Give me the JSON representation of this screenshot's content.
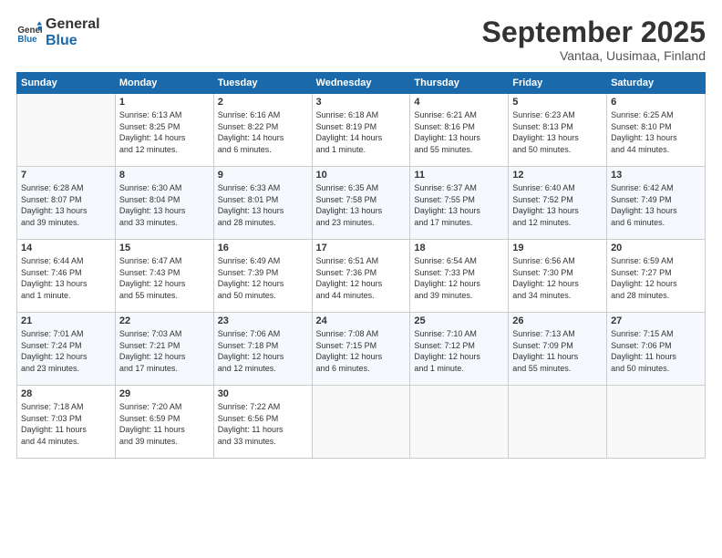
{
  "logo": {
    "line1": "General",
    "line2": "Blue"
  },
  "title": "September 2025",
  "subtitle": "Vantaa, Uusimaa, Finland",
  "headers": [
    "Sunday",
    "Monday",
    "Tuesday",
    "Wednesday",
    "Thursday",
    "Friday",
    "Saturday"
  ],
  "weeks": [
    [
      {
        "day": "",
        "info": ""
      },
      {
        "day": "1",
        "info": "Sunrise: 6:13 AM\nSunset: 8:25 PM\nDaylight: 14 hours\nand 12 minutes."
      },
      {
        "day": "2",
        "info": "Sunrise: 6:16 AM\nSunset: 8:22 PM\nDaylight: 14 hours\nand 6 minutes."
      },
      {
        "day": "3",
        "info": "Sunrise: 6:18 AM\nSunset: 8:19 PM\nDaylight: 14 hours\nand 1 minute."
      },
      {
        "day": "4",
        "info": "Sunrise: 6:21 AM\nSunset: 8:16 PM\nDaylight: 13 hours\nand 55 minutes."
      },
      {
        "day": "5",
        "info": "Sunrise: 6:23 AM\nSunset: 8:13 PM\nDaylight: 13 hours\nand 50 minutes."
      },
      {
        "day": "6",
        "info": "Sunrise: 6:25 AM\nSunset: 8:10 PM\nDaylight: 13 hours\nand 44 minutes."
      }
    ],
    [
      {
        "day": "7",
        "info": "Sunrise: 6:28 AM\nSunset: 8:07 PM\nDaylight: 13 hours\nand 39 minutes."
      },
      {
        "day": "8",
        "info": "Sunrise: 6:30 AM\nSunset: 8:04 PM\nDaylight: 13 hours\nand 33 minutes."
      },
      {
        "day": "9",
        "info": "Sunrise: 6:33 AM\nSunset: 8:01 PM\nDaylight: 13 hours\nand 28 minutes."
      },
      {
        "day": "10",
        "info": "Sunrise: 6:35 AM\nSunset: 7:58 PM\nDaylight: 13 hours\nand 23 minutes."
      },
      {
        "day": "11",
        "info": "Sunrise: 6:37 AM\nSunset: 7:55 PM\nDaylight: 13 hours\nand 17 minutes."
      },
      {
        "day": "12",
        "info": "Sunrise: 6:40 AM\nSunset: 7:52 PM\nDaylight: 13 hours\nand 12 minutes."
      },
      {
        "day": "13",
        "info": "Sunrise: 6:42 AM\nSunset: 7:49 PM\nDaylight: 13 hours\nand 6 minutes."
      }
    ],
    [
      {
        "day": "14",
        "info": "Sunrise: 6:44 AM\nSunset: 7:46 PM\nDaylight: 13 hours\nand 1 minute."
      },
      {
        "day": "15",
        "info": "Sunrise: 6:47 AM\nSunset: 7:43 PM\nDaylight: 12 hours\nand 55 minutes."
      },
      {
        "day": "16",
        "info": "Sunrise: 6:49 AM\nSunset: 7:39 PM\nDaylight: 12 hours\nand 50 minutes."
      },
      {
        "day": "17",
        "info": "Sunrise: 6:51 AM\nSunset: 7:36 PM\nDaylight: 12 hours\nand 44 minutes."
      },
      {
        "day": "18",
        "info": "Sunrise: 6:54 AM\nSunset: 7:33 PM\nDaylight: 12 hours\nand 39 minutes."
      },
      {
        "day": "19",
        "info": "Sunrise: 6:56 AM\nSunset: 7:30 PM\nDaylight: 12 hours\nand 34 minutes."
      },
      {
        "day": "20",
        "info": "Sunrise: 6:59 AM\nSunset: 7:27 PM\nDaylight: 12 hours\nand 28 minutes."
      }
    ],
    [
      {
        "day": "21",
        "info": "Sunrise: 7:01 AM\nSunset: 7:24 PM\nDaylight: 12 hours\nand 23 minutes."
      },
      {
        "day": "22",
        "info": "Sunrise: 7:03 AM\nSunset: 7:21 PM\nDaylight: 12 hours\nand 17 minutes."
      },
      {
        "day": "23",
        "info": "Sunrise: 7:06 AM\nSunset: 7:18 PM\nDaylight: 12 hours\nand 12 minutes."
      },
      {
        "day": "24",
        "info": "Sunrise: 7:08 AM\nSunset: 7:15 PM\nDaylight: 12 hours\nand 6 minutes."
      },
      {
        "day": "25",
        "info": "Sunrise: 7:10 AM\nSunset: 7:12 PM\nDaylight: 12 hours\nand 1 minute."
      },
      {
        "day": "26",
        "info": "Sunrise: 7:13 AM\nSunset: 7:09 PM\nDaylight: 11 hours\nand 55 minutes."
      },
      {
        "day": "27",
        "info": "Sunrise: 7:15 AM\nSunset: 7:06 PM\nDaylight: 11 hours\nand 50 minutes."
      }
    ],
    [
      {
        "day": "28",
        "info": "Sunrise: 7:18 AM\nSunset: 7:03 PM\nDaylight: 11 hours\nand 44 minutes."
      },
      {
        "day": "29",
        "info": "Sunrise: 7:20 AM\nSunset: 6:59 PM\nDaylight: 11 hours\nand 39 minutes."
      },
      {
        "day": "30",
        "info": "Sunrise: 7:22 AM\nSunset: 6:56 PM\nDaylight: 11 hours\nand 33 minutes."
      },
      {
        "day": "",
        "info": ""
      },
      {
        "day": "",
        "info": ""
      },
      {
        "day": "",
        "info": ""
      },
      {
        "day": "",
        "info": ""
      }
    ]
  ]
}
